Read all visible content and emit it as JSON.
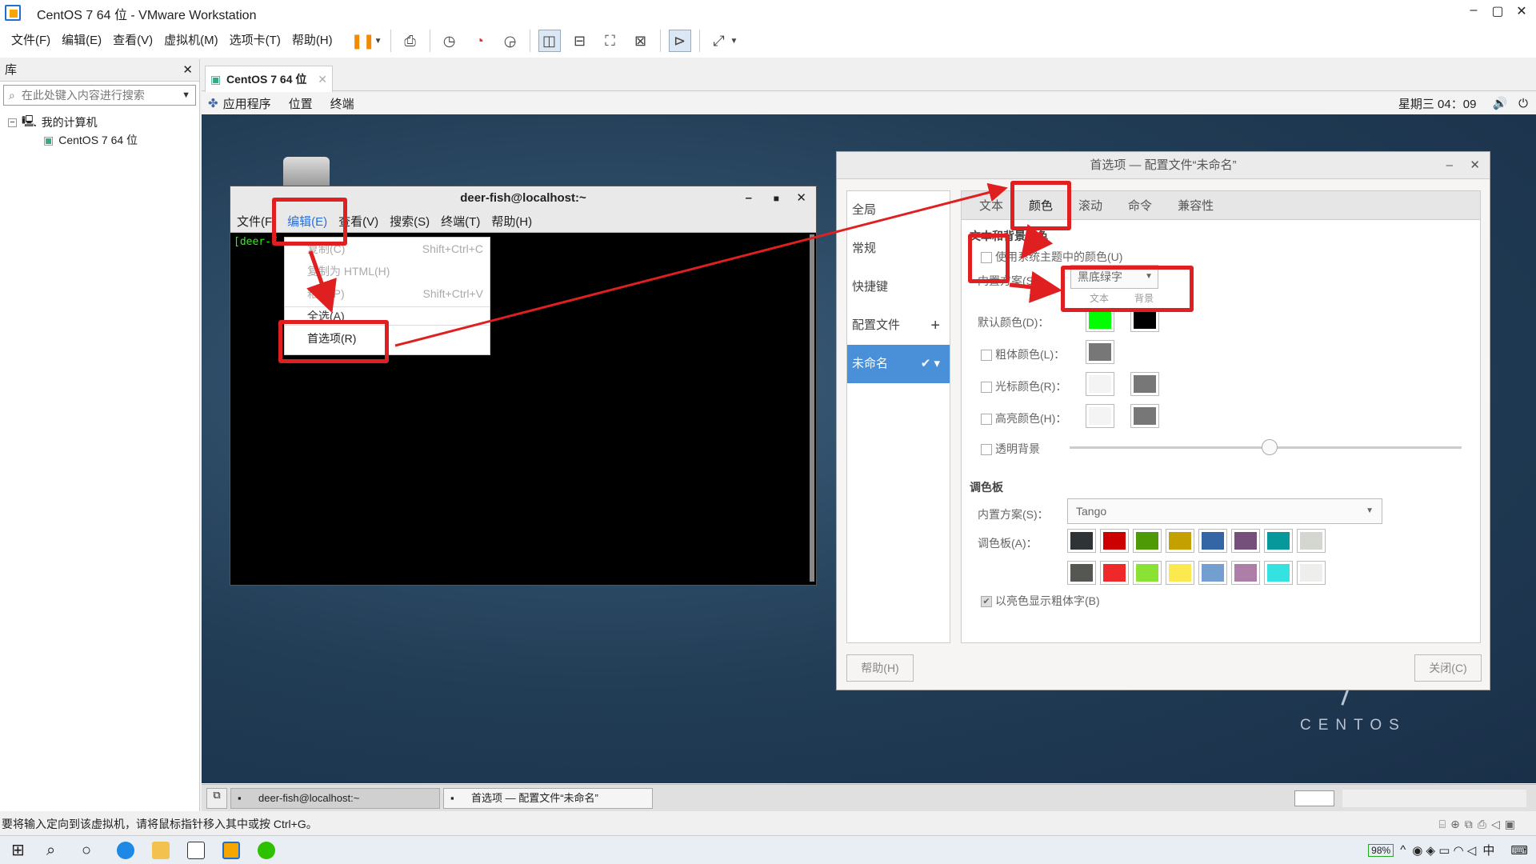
{
  "window": {
    "title": "CentOS 7 64 位 - VMware Workstation"
  },
  "menubar": {
    "items": [
      "文件(F)",
      "编辑(E)",
      "查看(V)",
      "虚拟机(M)",
      "选项卡(T)",
      "帮助(H)"
    ]
  },
  "library": {
    "title": "库",
    "search_placeholder": "在此处键入内容进行搜索",
    "root": "我的计算机",
    "vm": "CentOS 7 64 位"
  },
  "vm_tab": {
    "label": "CentOS 7 64 位"
  },
  "gnome": {
    "applications": "应用程序",
    "places": "位置",
    "terminal": "终端",
    "clock": "星期三 04：09",
    "brand": "CENTOS"
  },
  "terminal": {
    "title": "deer-fish@localhost:~",
    "menu": [
      "文件(F)",
      "编辑(E)",
      "查看(V)",
      "搜索(S)",
      "终端(T)",
      "帮助(H)"
    ],
    "prompt": "[deer-f"
  },
  "edit_menu": {
    "copy": "复制(C)",
    "copy_sc": "Shift+Ctrl+C",
    "copy_html": "复制为 HTML(H)",
    "paste": "粘贴(P)",
    "paste_sc": "Shift+Ctrl+V",
    "select_all": "全选(A)",
    "preferences": "首选项(R)"
  },
  "prefs": {
    "title": "首选项 — 配置文件“未命名”",
    "sidebar": {
      "global": "全局",
      "general": "常规",
      "shortcuts": "快捷键",
      "profiles": "配置文件",
      "profile_name": "未命名"
    },
    "tabs": [
      "文本",
      "颜色",
      "滚动",
      "命令",
      "兼容性"
    ],
    "section_text_bg": "文本和背景颜色",
    "use_system": "使用系统主题中的颜色(U)",
    "builtin_scheme_label": "内置方案(S)：",
    "builtin_scheme_value": "黑底绿字",
    "col_text": "文本",
    "col_bg": "背景",
    "default_color": "默认颜色(D)：",
    "bold_color": "粗体颜色(L)：",
    "cursor_color": "光标颜色(R)：",
    "highlight_color": "高亮颜色(H)：",
    "transparent": "透明背景",
    "palette_section": "调色板",
    "palette_scheme_label": "内置方案(S)：",
    "palette_scheme_value": "Tango",
    "palette_label": "调色板(A)：",
    "bright_bold": "以亮色显示粗体字(B)",
    "help": "帮助(H)",
    "close": "关闭(C)",
    "colors": {
      "default_text": "#00ff00",
      "default_bg": "#000000",
      "bold": "#777777",
      "cursor_text": "#f4f4f4",
      "cursor_bg": "#777777",
      "highlight_text": "#f4f4f4",
      "highlight_bg": "#777777"
    },
    "palette_row1": [
      "#2e3436",
      "#cc0000",
      "#4e9a06",
      "#c4a000",
      "#3465a4",
      "#75507b",
      "#06989a",
      "#d3d7cf"
    ],
    "palette_row2": [
      "#555753",
      "#ef2929",
      "#8ae234",
      "#fce94f",
      "#729fcf",
      "#ad7fa8",
      "#34e2e2",
      "#eeeeec"
    ]
  },
  "vm_taskbar": {
    "term": "deer-fish@localhost:~",
    "prefs": "首选项 — 配置文件“未命名”"
  },
  "status": {
    "message": "要将输入定向到该虚拟机，请将鼠标指针移入其中或按 Ctrl+G。"
  },
  "win_taskbar": {
    "battery": "98%",
    "ime": "中"
  }
}
